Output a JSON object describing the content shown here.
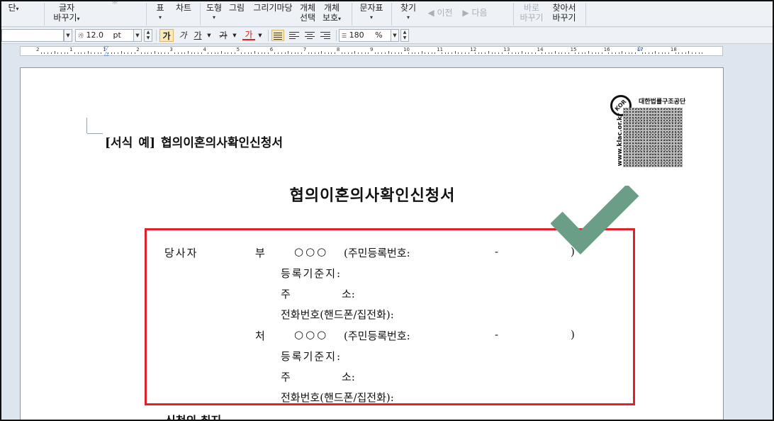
{
  "ribbon": {
    "items": [
      {
        "line1": "",
        "line2": "단",
        "dropdown": true
      },
      {
        "line1": "글자",
        "line2": "바꾸기",
        "dropdown": true
      },
      {
        "line1": "표",
        "line2": "",
        "dropdown": true
      },
      {
        "line1": "차트",
        "line2": "",
        "dropdown": false
      },
      {
        "line1": "도형",
        "line2": "",
        "dropdown": true
      },
      {
        "line1": "그림",
        "line2": "",
        "dropdown": false
      },
      {
        "line1": "그리기마당",
        "line2": "",
        "dropdown": false
      },
      {
        "line1": "개체",
        "line2": "선택",
        "dropdown": false
      },
      {
        "line1": "개체",
        "line2": "보호",
        "dropdown": true
      },
      {
        "line1": "문자표",
        "line2": "",
        "dropdown": true
      },
      {
        "line1": "찾기",
        "line2": "",
        "dropdown": true
      },
      {
        "line1": "이전",
        "line2": "",
        "dropdown": false,
        "disabled": true
      },
      {
        "line1": "다음",
        "line2": "",
        "dropdown": false,
        "disabled": true
      },
      {
        "line1": "바로",
        "line2": "바꾸기",
        "dropdown": false,
        "disabled": true
      },
      {
        "line1": "찾아서",
        "line2": "바꾸기",
        "dropdown": false
      }
    ]
  },
  "format_bar": {
    "font_size": "12.0",
    "font_size_unit": "pt",
    "line_spacing": "180",
    "line_spacing_unit": "%",
    "buttons": [
      "가",
      "가",
      "가",
      "가",
      "가"
    ]
  },
  "ruler": {
    "numbers": [
      "2",
      "1",
      "1",
      "2",
      "3",
      "4",
      "5",
      "6",
      "7",
      "8",
      "9",
      "10",
      "11",
      "12",
      "13",
      "14",
      "15",
      "16",
      "17",
      "18"
    ]
  },
  "document": {
    "form_label_bracket_open": "[서식",
    "form_label_example": "예]",
    "form_label_title": "협의이혼의사확인신청서",
    "title": "협의이혼의사확인신청서",
    "logo": {
      "org": "대한법률구조공단",
      "url": "www.klac.or.kr",
      "badge": "KOR"
    },
    "applicants": {
      "party_label": "당사자",
      "husband": {
        "label": "부",
        "name": "○○○",
        "rrn_label": "(주민등록번호:",
        "rrn_dash": "-",
        "rrn_close": ")",
        "registry_label": "등록기준지:",
        "address_label_1": "주",
        "address_label_2": "소:",
        "phone_label": "전화번호(핸드폰/집전화):"
      },
      "wife": {
        "label": "처",
        "name": "○○○",
        "rrn_label": "(주민등록번호:",
        "rrn_dash": "-",
        "rrn_close": ")",
        "registry_label": "등록기준지:",
        "address_label_1": "주",
        "address_label_2": "소:",
        "phone_label": "전화번호(핸드폰/집전화):"
      }
    },
    "next_heading": "신청의 취지"
  },
  "colors": {
    "highlight_box": "#e0202a",
    "checkmark": "#6b9e87",
    "toolbar_bg": "#eef2f6",
    "workspace_bg": "#dde6ee"
  }
}
